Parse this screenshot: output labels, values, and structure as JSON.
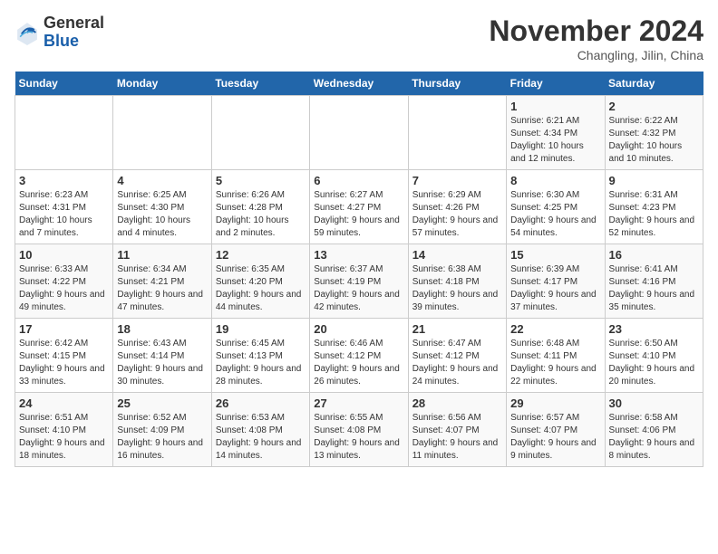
{
  "header": {
    "logo_general": "General",
    "logo_blue": "Blue",
    "month_title": "November 2024",
    "subtitle": "Changling, Jilin, China"
  },
  "days_of_week": [
    "Sunday",
    "Monday",
    "Tuesday",
    "Wednesday",
    "Thursday",
    "Friday",
    "Saturday"
  ],
  "weeks": [
    [
      {
        "day": "",
        "info": ""
      },
      {
        "day": "",
        "info": ""
      },
      {
        "day": "",
        "info": ""
      },
      {
        "day": "",
        "info": ""
      },
      {
        "day": "",
        "info": ""
      },
      {
        "day": "1",
        "info": "Sunrise: 6:21 AM\nSunset: 4:34 PM\nDaylight: 10 hours and 12 minutes."
      },
      {
        "day": "2",
        "info": "Sunrise: 6:22 AM\nSunset: 4:32 PM\nDaylight: 10 hours and 10 minutes."
      }
    ],
    [
      {
        "day": "3",
        "info": "Sunrise: 6:23 AM\nSunset: 4:31 PM\nDaylight: 10 hours and 7 minutes."
      },
      {
        "day": "4",
        "info": "Sunrise: 6:25 AM\nSunset: 4:30 PM\nDaylight: 10 hours and 4 minutes."
      },
      {
        "day": "5",
        "info": "Sunrise: 6:26 AM\nSunset: 4:28 PM\nDaylight: 10 hours and 2 minutes."
      },
      {
        "day": "6",
        "info": "Sunrise: 6:27 AM\nSunset: 4:27 PM\nDaylight: 9 hours and 59 minutes."
      },
      {
        "day": "7",
        "info": "Sunrise: 6:29 AM\nSunset: 4:26 PM\nDaylight: 9 hours and 57 minutes."
      },
      {
        "day": "8",
        "info": "Sunrise: 6:30 AM\nSunset: 4:25 PM\nDaylight: 9 hours and 54 minutes."
      },
      {
        "day": "9",
        "info": "Sunrise: 6:31 AM\nSunset: 4:23 PM\nDaylight: 9 hours and 52 minutes."
      }
    ],
    [
      {
        "day": "10",
        "info": "Sunrise: 6:33 AM\nSunset: 4:22 PM\nDaylight: 9 hours and 49 minutes."
      },
      {
        "day": "11",
        "info": "Sunrise: 6:34 AM\nSunset: 4:21 PM\nDaylight: 9 hours and 47 minutes."
      },
      {
        "day": "12",
        "info": "Sunrise: 6:35 AM\nSunset: 4:20 PM\nDaylight: 9 hours and 44 minutes."
      },
      {
        "day": "13",
        "info": "Sunrise: 6:37 AM\nSunset: 4:19 PM\nDaylight: 9 hours and 42 minutes."
      },
      {
        "day": "14",
        "info": "Sunrise: 6:38 AM\nSunset: 4:18 PM\nDaylight: 9 hours and 39 minutes."
      },
      {
        "day": "15",
        "info": "Sunrise: 6:39 AM\nSunset: 4:17 PM\nDaylight: 9 hours and 37 minutes."
      },
      {
        "day": "16",
        "info": "Sunrise: 6:41 AM\nSunset: 4:16 PM\nDaylight: 9 hours and 35 minutes."
      }
    ],
    [
      {
        "day": "17",
        "info": "Sunrise: 6:42 AM\nSunset: 4:15 PM\nDaylight: 9 hours and 33 minutes."
      },
      {
        "day": "18",
        "info": "Sunrise: 6:43 AM\nSunset: 4:14 PM\nDaylight: 9 hours and 30 minutes."
      },
      {
        "day": "19",
        "info": "Sunrise: 6:45 AM\nSunset: 4:13 PM\nDaylight: 9 hours and 28 minutes."
      },
      {
        "day": "20",
        "info": "Sunrise: 6:46 AM\nSunset: 4:12 PM\nDaylight: 9 hours and 26 minutes."
      },
      {
        "day": "21",
        "info": "Sunrise: 6:47 AM\nSunset: 4:12 PM\nDaylight: 9 hours and 24 minutes."
      },
      {
        "day": "22",
        "info": "Sunrise: 6:48 AM\nSunset: 4:11 PM\nDaylight: 9 hours and 22 minutes."
      },
      {
        "day": "23",
        "info": "Sunrise: 6:50 AM\nSunset: 4:10 PM\nDaylight: 9 hours and 20 minutes."
      }
    ],
    [
      {
        "day": "24",
        "info": "Sunrise: 6:51 AM\nSunset: 4:10 PM\nDaylight: 9 hours and 18 minutes."
      },
      {
        "day": "25",
        "info": "Sunrise: 6:52 AM\nSunset: 4:09 PM\nDaylight: 9 hours and 16 minutes."
      },
      {
        "day": "26",
        "info": "Sunrise: 6:53 AM\nSunset: 4:08 PM\nDaylight: 9 hours and 14 minutes."
      },
      {
        "day": "27",
        "info": "Sunrise: 6:55 AM\nSunset: 4:08 PM\nDaylight: 9 hours and 13 minutes."
      },
      {
        "day": "28",
        "info": "Sunrise: 6:56 AM\nSunset: 4:07 PM\nDaylight: 9 hours and 11 minutes."
      },
      {
        "day": "29",
        "info": "Sunrise: 6:57 AM\nSunset: 4:07 PM\nDaylight: 9 hours and 9 minutes."
      },
      {
        "day": "30",
        "info": "Sunrise: 6:58 AM\nSunset: 4:06 PM\nDaylight: 9 hours and 8 minutes."
      }
    ]
  ]
}
